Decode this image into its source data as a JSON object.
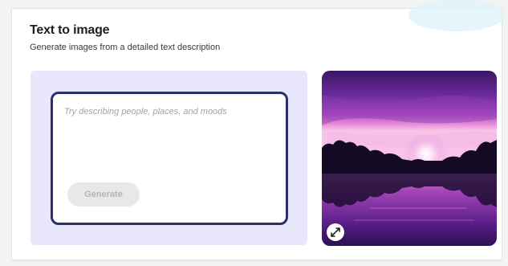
{
  "card": {
    "title": "Text to image",
    "subtitle": "Generate images from a detailed text description"
  },
  "prompt": {
    "placeholder": "Try describing people, places, and moods",
    "value": ""
  },
  "actions": {
    "generate_label": "Generate"
  },
  "preview": {
    "image_icon": "sunset-lake-image",
    "expand_icon": "expand-icon"
  },
  "colors": {
    "panel_bg": "#e8e7fb",
    "prompt_border": "#2c2f6b",
    "button_disabled_bg": "#e8e8e8",
    "button_disabled_text": "#b4b4b4"
  }
}
